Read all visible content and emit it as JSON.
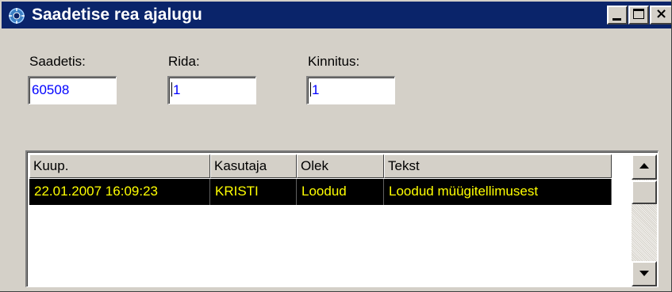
{
  "window": {
    "title": "Saadetise rea ajalugu",
    "title_bar_color": "#0a246a",
    "controls": {
      "minimize_icon": "minimize-icon",
      "maximize_icon": "maximize-icon",
      "close_icon": "close-icon",
      "close_glyph": "×"
    }
  },
  "fields": {
    "saadetis": {
      "label": "Saadetis:",
      "value": "60508"
    },
    "rida": {
      "label": "Rida:",
      "value": "1"
    },
    "kinnitus": {
      "label": "Kinnitus:",
      "value": "1"
    }
  },
  "grid": {
    "columns": [
      "Kuup.",
      "Kasutaja",
      "Olek",
      "Tekst"
    ],
    "rows": [
      {
        "date": "22.01.2007 16:09:23",
        "user": "KRISTI",
        "state": "Loodud",
        "text": "Loodud müügitellimusest"
      }
    ],
    "selected_row_bg": "#000000",
    "selected_row_fg": "#ffff00"
  },
  "scrollbar": {
    "up_icon": "scroll-up-arrow-icon",
    "down_icon": "scroll-down-arrow-icon"
  }
}
